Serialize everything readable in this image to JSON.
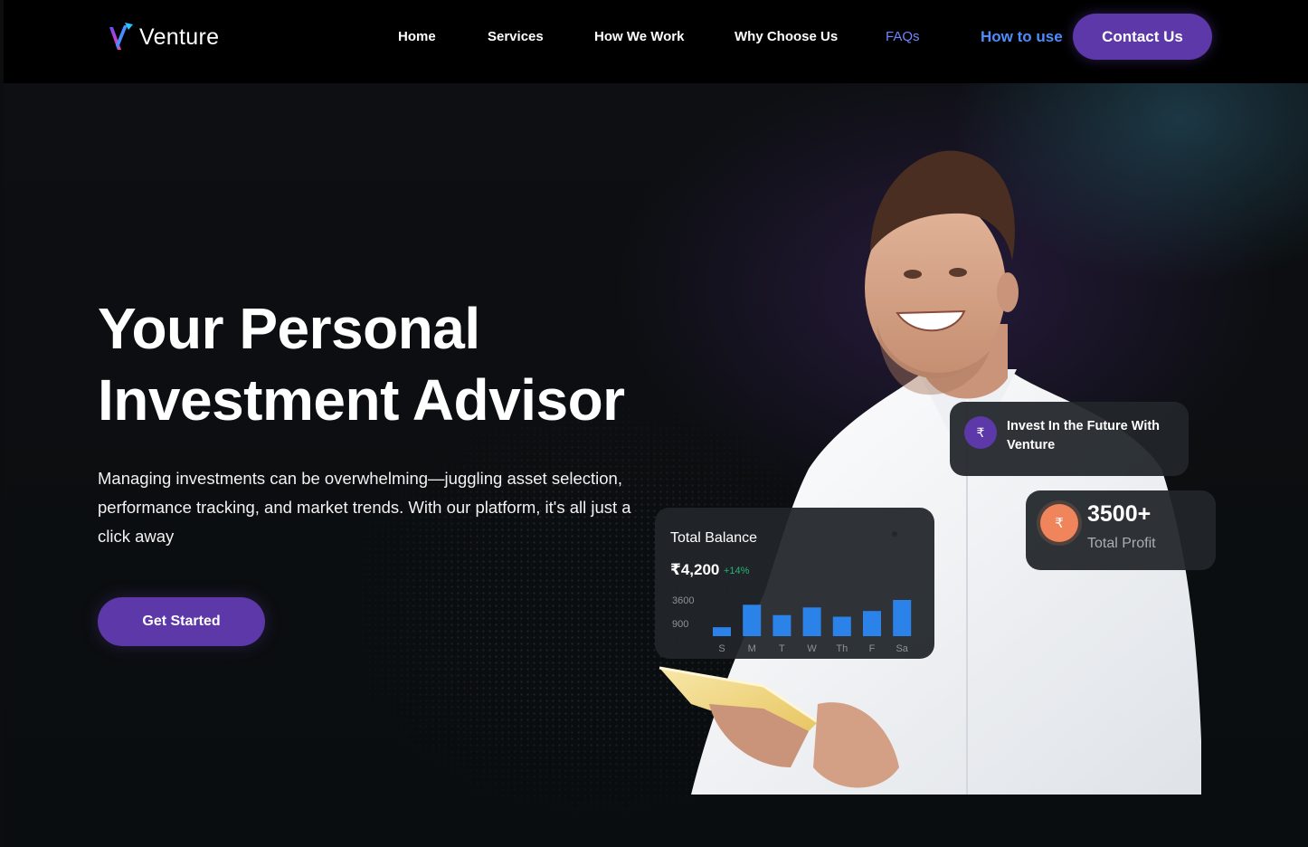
{
  "brand": {
    "name": "Venture",
    "logo_icon": "v-logo-icon",
    "logo_colors": [
      "#6d4bff",
      "#ff3d9a",
      "#29c4ff"
    ]
  },
  "nav": {
    "items": [
      {
        "label": "Home"
      },
      {
        "label": "Services"
      },
      {
        "label": "How We Work"
      },
      {
        "label": "Why Choose Us"
      },
      {
        "label": "FAQs"
      }
    ],
    "how_to_use": "How to use",
    "contact": "Contact Us"
  },
  "hero": {
    "headline_line1": "Your Personal",
    "headline_line2": "Investment Advisor",
    "description": "Managing investments can be overwhelming—juggling asset selection, performance tracking, and market trends. With our platform, it's all just a click away",
    "cta": "Get Started",
    "person_image": "smiling-man-with-tablet-photo"
  },
  "balance_card": {
    "title": "Total Balance",
    "amount": "₹4,200",
    "change": "+14%",
    "chart_data": {
      "type": "bar",
      "categories": [
        "S",
        "M",
        "T",
        "W",
        "Th",
        "F",
        "Sa"
      ],
      "values": [
        500,
        1760,
        1180,
        1610,
        1090,
        1410,
        2030
      ],
      "y_ticks": [
        "3600",
        "900"
      ],
      "color": "#2b83ea"
    }
  },
  "invest_card": {
    "icon": "₹",
    "text": "Invest In the Future With Venture"
  },
  "profit_card": {
    "icon": "₹",
    "value": "3500+",
    "label": "Total Profit"
  },
  "colors": {
    "accent": "#5c38a8",
    "link_blue": "#4f8dff",
    "profit_orange": "#f0845a",
    "positive_green": "#22b573"
  }
}
